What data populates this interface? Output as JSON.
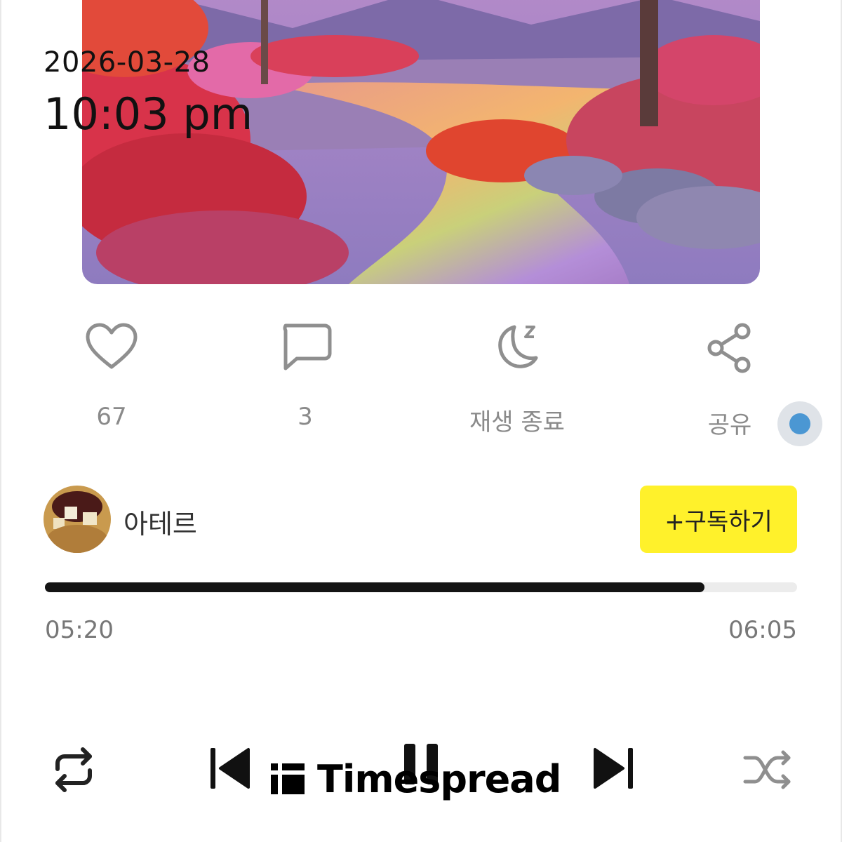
{
  "overlay": {
    "date": "2026-03-28",
    "time": "10:03 pm"
  },
  "actions": {
    "like_count": "67",
    "comment_count": "3",
    "sleep_label": "재생 종료",
    "share_label": "공유"
  },
  "creator": {
    "name": "아테르",
    "subscribe_label": "+구독하기"
  },
  "player": {
    "elapsed": "05:20",
    "total": "06:05",
    "progress": 0.877
  },
  "watermark": {
    "text": "Timespread"
  },
  "colors": {
    "subscribe_bg": "#fff12b",
    "accent_dot": "#4b97d3",
    "progress_fill": "#141414"
  }
}
